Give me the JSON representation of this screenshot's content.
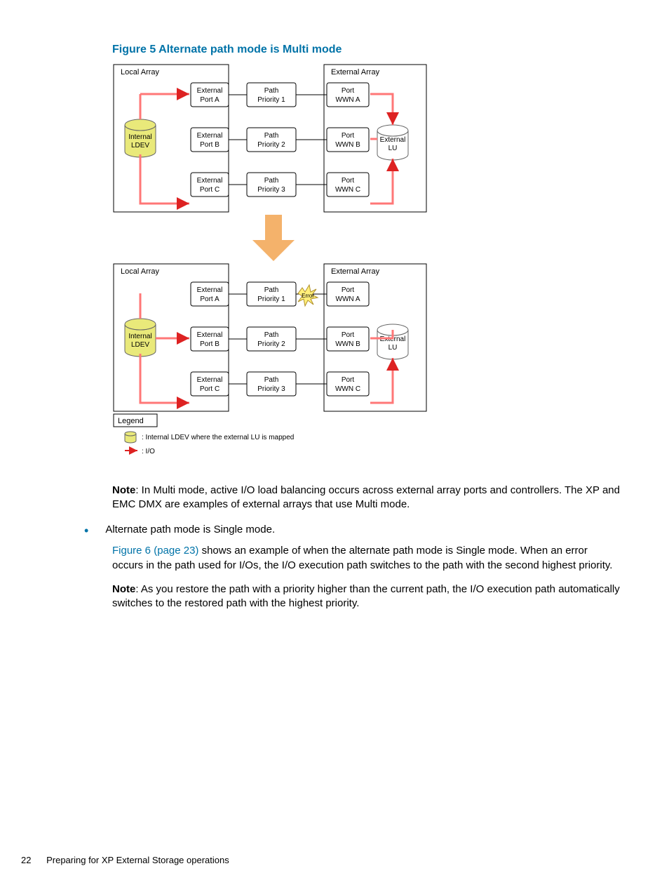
{
  "figure_title": "Figure 5 Alternate path mode is Multi mode",
  "note1_label": "Note",
  "note1_text": ": In Multi mode, active I/O load balancing occurs across external array ports and controllers. The XP and EMC DMX are examples of external arrays that use Multi mode.",
  "bullet_text": "Alternate path mode is Single mode.",
  "link_text": "Figure 6 (page 23)",
  "para1_rest": " shows an example of when the alternate path mode is Single mode. When an error occurs in the path used for I/Os, the I/O execution path switches to the path with the second highest priority.",
  "note2_label": "Note",
  "note2_text": ": As you restore the path with a priority higher than the current path, the I/O execution path automatically switches to the restored path with the highest priority.",
  "footer_page": "22",
  "footer_text": "Preparing for XP External Storage operations",
  "diagram": {
    "top": {
      "local_label": "Local Array",
      "external_label": "External Array",
      "internal_ldev": [
        "Internal",
        "LDEV"
      ],
      "external_lu": [
        "External",
        "LU"
      ],
      "rows": [
        {
          "ext": [
            "External",
            "Port A"
          ],
          "path": [
            "Path",
            "Priority 1"
          ],
          "port": [
            "Port",
            "WWN A"
          ]
        },
        {
          "ext": [
            "External",
            "Port B"
          ],
          "path": [
            "Path",
            "Priority 2"
          ],
          "port": [
            "Port",
            "WWN B"
          ]
        },
        {
          "ext": [
            "External",
            "Port C"
          ],
          "path": [
            "Path",
            "Priority 3"
          ],
          "port": [
            "Port",
            "WWN C"
          ]
        }
      ]
    },
    "bottom": {
      "local_label": "Local Array",
      "external_label": "External Array",
      "internal_ldev": [
        "Internal",
        "LDEV"
      ],
      "external_lu": [
        "External",
        "LU"
      ],
      "error": "Error",
      "rows": [
        {
          "ext": [
            "External",
            "Port A"
          ],
          "path": [
            "Path",
            "Priority 1"
          ],
          "port": [
            "Port",
            "WWN A"
          ]
        },
        {
          "ext": [
            "External",
            "Port B"
          ],
          "path": [
            "Path",
            "Priority 2"
          ],
          "port": [
            "Port",
            "WWN B"
          ]
        },
        {
          "ext": [
            "External",
            "Port C"
          ],
          "path": [
            "Path",
            "Priority 3"
          ],
          "port": [
            "Port",
            "WWN C"
          ]
        }
      ]
    },
    "legend": {
      "title": "Legend",
      "item1": ": Internal LDEV where the external LU is mapped",
      "item2": ": I/O"
    }
  }
}
